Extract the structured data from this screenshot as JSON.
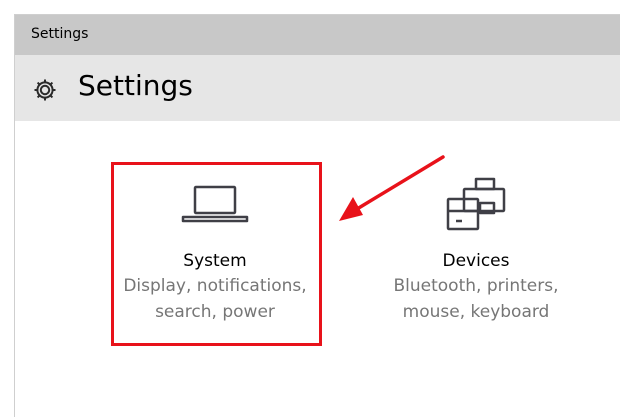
{
  "window": {
    "title": "Settings"
  },
  "header": {
    "title": "Settings",
    "icon": "gear-icon"
  },
  "tiles": [
    {
      "title": "System",
      "desc_line1": "Display, notifications,",
      "desc_line2": "search, power",
      "icon": "laptop-icon",
      "highlighted": true
    },
    {
      "title": "Devices",
      "desc_line1": "Bluetooth, printers,",
      "desc_line2": "mouse, keyboard",
      "icon": "printer-icon",
      "highlighted": false
    }
  ],
  "colors": {
    "titlebar": "#c8c8c8",
    "header": "#e6e6e6",
    "annotation": "#e8121a",
    "icon_stroke": "#3f3f46",
    "desc_text": "#767676"
  }
}
